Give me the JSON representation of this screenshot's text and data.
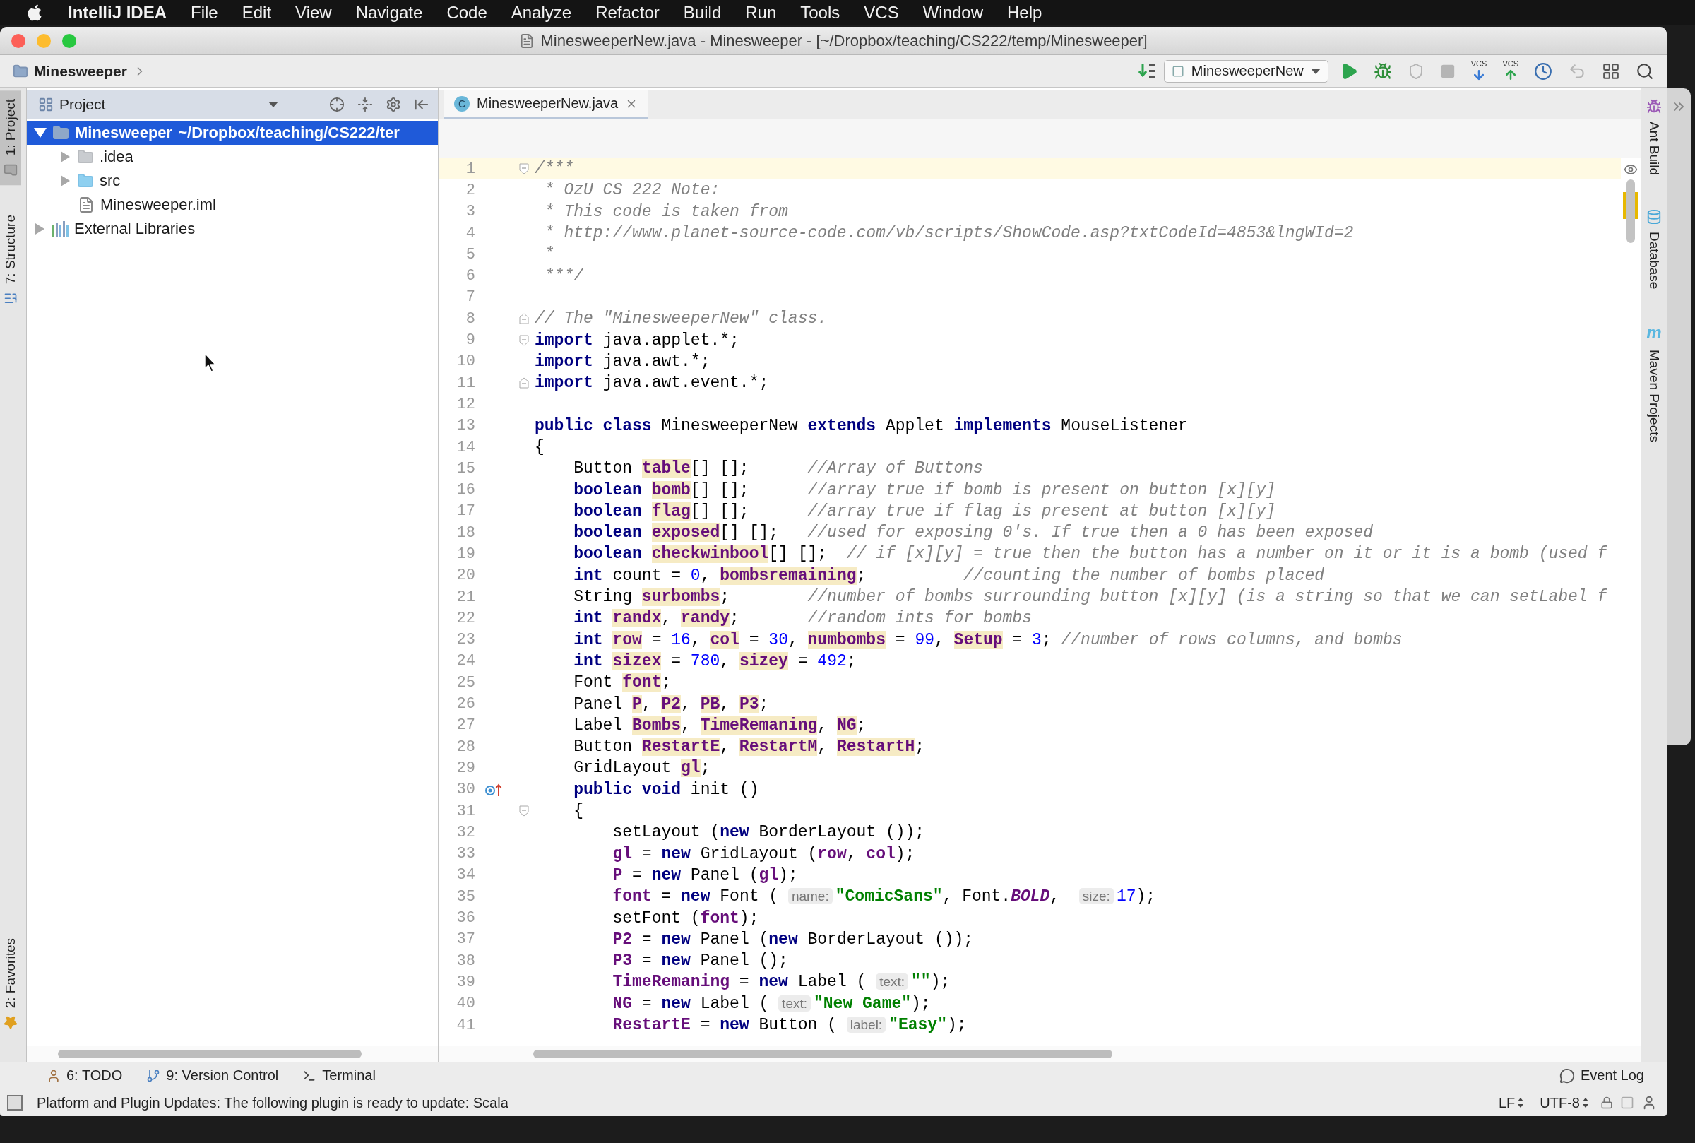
{
  "menu_bar": {
    "app": "IntelliJ IDEA",
    "items": [
      "File",
      "Edit",
      "View",
      "Navigate",
      "Code",
      "Analyze",
      "Refactor",
      "Build",
      "Run",
      "Tools",
      "VCS",
      "Window",
      "Help"
    ]
  },
  "window": {
    "title": "MinesweeperNew.java - Minesweeper - [~/Dropbox/teaching/CS222/temp/Minesweeper]"
  },
  "navigation_bar": {
    "breadcrumb": "Minesweeper",
    "run_config": "MinesweeperNew",
    "toolbar": [
      {
        "kind": "run",
        "disabled": false
      },
      {
        "kind": "debug",
        "disabled": false
      },
      {
        "kind": "coverage",
        "disabled": true
      },
      {
        "kind": "stop",
        "disabled": true
      },
      {
        "kind": "vcs-update",
        "label": "VCS",
        "disabled": false
      },
      {
        "kind": "vcs-commit",
        "label": "VCS",
        "disabled": false
      },
      {
        "kind": "history",
        "disabled": false
      },
      {
        "kind": "revert",
        "disabled": true
      },
      {
        "kind": "structure",
        "disabled": false
      },
      {
        "kind": "search",
        "disabled": false
      }
    ]
  },
  "left_stripe": [
    {
      "label": "1: Project",
      "kind": "project",
      "selected": true
    },
    {
      "label": "7: Structure",
      "kind": "structure",
      "selected": false
    },
    {
      "label": "2: Favorites",
      "kind": "favorites",
      "selected": false
    }
  ],
  "project_panel": {
    "title": "Project",
    "tree": [
      {
        "label": "Minesweeper",
        "path": "~/Dropbox/teaching/CS222/ter",
        "kind": "module",
        "expanded": true,
        "selected": true,
        "children": [
          {
            "label": ".idea",
            "kind": "folder",
            "expanded": false,
            "selected": false
          },
          {
            "label": "src",
            "kind": "source",
            "expanded": false,
            "selected": false
          },
          {
            "label": "Minesweeper.iml",
            "kind": "file",
            "selected": false
          }
        ]
      },
      {
        "label": "External Libraries",
        "kind": "libraries",
        "expanded": false,
        "selected": false
      }
    ]
  },
  "editor": {
    "tabs": [
      {
        "label": "MinesweeperNew.java",
        "badge": "C",
        "selected": true
      }
    ],
    "lines": [
      {
        "n": "1",
        "current": true,
        "fold": {
          "kind": "start"
        },
        "tokens": [
          {
            "kind": "cm",
            "text": "/***"
          }
        ]
      },
      {
        "n": "2",
        "current": false,
        "tokens": [
          {
            "kind": "cm",
            "text": " * OzU CS 222 Note:"
          }
        ]
      },
      {
        "n": "3",
        "current": false,
        "tokens": [
          {
            "kind": "cm",
            "text": " * This code is taken from"
          }
        ]
      },
      {
        "n": "4",
        "current": false,
        "tokens": [
          {
            "kind": "cm",
            "text": " * http://www.planet-source-code.com/vb/scripts/ShowCode.asp?txtCodeId=4853&lngWId=2"
          }
        ]
      },
      {
        "n": "5",
        "current": false,
        "tokens": [
          {
            "kind": "cm",
            "text": " *"
          }
        ]
      },
      {
        "n": "6",
        "current": false,
        "tokens": [
          {
            "kind": "cm",
            "text": " ***/"
          }
        ]
      },
      {
        "n": "7",
        "current": false
      },
      {
        "n": "8",
        "current": false,
        "fold": {
          "kind": "end"
        },
        "tokens": [
          {
            "kind": "cm",
            "text": "// The \"MinesweeperNew\" class."
          }
        ]
      },
      {
        "n": "9",
        "current": false,
        "fold": {
          "kind": "start"
        },
        "tokens": [
          {
            "kind": "kw",
            "text": "import"
          },
          {
            "kind": "tx",
            "text": " java.applet.*;"
          }
        ]
      },
      {
        "n": "10",
        "current": false,
        "tokens": [
          {
            "kind": "kw",
            "text": "import"
          },
          {
            "kind": "tx",
            "text": " java.awt.*;"
          }
        ]
      },
      {
        "n": "11",
        "current": false,
        "fold": {
          "kind": "end"
        },
        "tokens": [
          {
            "kind": "kw",
            "text": "import"
          },
          {
            "kind": "tx",
            "text": " java.awt.event.*;"
          }
        ]
      },
      {
        "n": "12",
        "current": false
      },
      {
        "n": "13",
        "current": false,
        "tokens": [
          {
            "kind": "kw",
            "text": "public class"
          },
          {
            "kind": "tx",
            "text": " MinesweeperNew "
          },
          {
            "kind": "kw",
            "text": "extends"
          },
          {
            "kind": "tx",
            "text": " Applet "
          },
          {
            "kind": "kw",
            "text": "implements"
          },
          {
            "kind": "tx",
            "text": " MouseListener"
          }
        ]
      },
      {
        "n": "14",
        "current": false,
        "tokens": [
          {
            "kind": "tx",
            "text": "{"
          }
        ]
      },
      {
        "n": "15",
        "current": false,
        "tokens": [
          {
            "kind": "tx",
            "text": "    Button "
          },
          {
            "kind": "fdh",
            "text": "table"
          },
          {
            "kind": "tx",
            "text": "[] [];      "
          },
          {
            "kind": "cm",
            "text": "//Array of Buttons"
          }
        ]
      },
      {
        "n": "16",
        "current": false,
        "tokens": [
          {
            "kind": "kw",
            "text": "    boolean "
          },
          {
            "kind": "fdh",
            "text": "bomb"
          },
          {
            "kind": "tx",
            "text": "[] [];      "
          },
          {
            "kind": "cm",
            "text": "//array true if bomb is present on button [x][y]"
          }
        ]
      },
      {
        "n": "17",
        "current": false,
        "tokens": [
          {
            "kind": "kw",
            "text": "    boolean "
          },
          {
            "kind": "fdh",
            "text": "flag"
          },
          {
            "kind": "tx",
            "text": "[] [];      "
          },
          {
            "kind": "cm",
            "text": "//array true if flag is present at button [x][y]"
          }
        ]
      },
      {
        "n": "18",
        "current": false,
        "tokens": [
          {
            "kind": "kw",
            "text": "    boolean "
          },
          {
            "kind": "fdh",
            "text": "exposed"
          },
          {
            "kind": "tx",
            "text": "[] [];   "
          },
          {
            "kind": "cm",
            "text": "//used for exposing 0's. If true then a 0 has been exposed"
          }
        ]
      },
      {
        "n": "19",
        "current": false,
        "tokens": [
          {
            "kind": "kw",
            "text": "    boolean "
          },
          {
            "kind": "fdh",
            "text": "checkwinbool"
          },
          {
            "kind": "tx",
            "text": "[] [];  "
          },
          {
            "kind": "cm",
            "text": "// if [x][y] = true then the button has a number on it or it is a bomb (used f"
          }
        ]
      },
      {
        "n": "20",
        "current": false,
        "tokens": [
          {
            "kind": "kw",
            "text": "    int"
          },
          {
            "kind": "tx",
            "text": " count = "
          },
          {
            "kind": "num",
            "text": "0"
          },
          {
            "kind": "tx",
            "text": ", "
          },
          {
            "kind": "fdh",
            "text": "bombsremaining"
          },
          {
            "kind": "tx",
            "text": ";          "
          },
          {
            "kind": "cm",
            "text": "//counting the number of bombs placed"
          }
        ]
      },
      {
        "n": "21",
        "current": false,
        "tokens": [
          {
            "kind": "tx",
            "text": "    String "
          },
          {
            "kind": "fdh",
            "text": "surbombs"
          },
          {
            "kind": "tx",
            "text": ";        "
          },
          {
            "kind": "cm",
            "text": "//number of bombs surrounding button [x][y] (is a string so that we can setLabel f"
          }
        ]
      },
      {
        "n": "22",
        "current": false,
        "tokens": [
          {
            "kind": "kw",
            "text": "    int "
          },
          {
            "kind": "fdh",
            "text": "randx"
          },
          {
            "kind": "tx",
            "text": ", "
          },
          {
            "kind": "fdh",
            "text": "randy"
          },
          {
            "kind": "tx",
            "text": ";       "
          },
          {
            "kind": "cm",
            "text": "//random ints for bombs"
          }
        ]
      },
      {
        "n": "23",
        "current": false,
        "tokens": [
          {
            "kind": "kw",
            "text": "    int "
          },
          {
            "kind": "fdh",
            "text": "row"
          },
          {
            "kind": "tx",
            "text": " = "
          },
          {
            "kind": "num",
            "text": "16"
          },
          {
            "kind": "tx",
            "text": ", "
          },
          {
            "kind": "fdh",
            "text": "col"
          },
          {
            "kind": "tx",
            "text": " = "
          },
          {
            "kind": "num",
            "text": "30"
          },
          {
            "kind": "tx",
            "text": ", "
          },
          {
            "kind": "fdh",
            "text": "numbombs"
          },
          {
            "kind": "tx",
            "text": " = "
          },
          {
            "kind": "num",
            "text": "99"
          },
          {
            "kind": "tx",
            "text": ", "
          },
          {
            "kind": "fdh",
            "text": "Setup"
          },
          {
            "kind": "tx",
            "text": " = "
          },
          {
            "kind": "num",
            "text": "3"
          },
          {
            "kind": "tx",
            "text": "; "
          },
          {
            "kind": "cm",
            "text": "//number of rows columns, and bombs"
          }
        ]
      },
      {
        "n": "24",
        "current": false,
        "tokens": [
          {
            "kind": "kw",
            "text": "    int "
          },
          {
            "kind": "fdh",
            "text": "sizex"
          },
          {
            "kind": "tx",
            "text": " = "
          },
          {
            "kind": "num",
            "text": "780"
          },
          {
            "kind": "tx",
            "text": ", "
          },
          {
            "kind": "fdh",
            "text": "sizey"
          },
          {
            "kind": "tx",
            "text": " = "
          },
          {
            "kind": "num",
            "text": "492"
          },
          {
            "kind": "tx",
            "text": ";"
          }
        ]
      },
      {
        "n": "25",
        "current": false,
        "tokens": [
          {
            "kind": "tx",
            "text": "    Font "
          },
          {
            "kind": "fdh",
            "text": "font"
          },
          {
            "kind": "tx",
            "text": ";"
          }
        ]
      },
      {
        "n": "26",
        "current": false,
        "tokens": [
          {
            "kind": "tx",
            "text": "    Panel "
          },
          {
            "kind": "fdh",
            "text": "P"
          },
          {
            "kind": "tx",
            "text": ", "
          },
          {
            "kind": "fdh",
            "text": "P2"
          },
          {
            "kind": "tx",
            "text": ", "
          },
          {
            "kind": "fdh",
            "text": "PB"
          },
          {
            "kind": "tx",
            "text": ", "
          },
          {
            "kind": "fdh",
            "text": "P3"
          },
          {
            "kind": "tx",
            "text": ";"
          }
        ]
      },
      {
        "n": "27",
        "current": false,
        "tokens": [
          {
            "kind": "tx",
            "text": "    Label "
          },
          {
            "kind": "fdh",
            "text": "Bombs"
          },
          {
            "kind": "tx",
            "text": ", "
          },
          {
            "kind": "fdh",
            "text": "TimeRemaning"
          },
          {
            "kind": "tx",
            "text": ", "
          },
          {
            "kind": "fdh",
            "text": "NG"
          },
          {
            "kind": "tx",
            "text": ";"
          }
        ]
      },
      {
        "n": "28",
        "current": false,
        "tokens": [
          {
            "kind": "tx",
            "text": "    Button "
          },
          {
            "kind": "fdh",
            "text": "RestartE"
          },
          {
            "kind": "tx",
            "text": ", "
          },
          {
            "kind": "fdh",
            "text": "RestartM"
          },
          {
            "kind": "tx",
            "text": ", "
          },
          {
            "kind": "fdh",
            "text": "RestartH"
          },
          {
            "kind": "tx",
            "text": ";"
          }
        ]
      },
      {
        "n": "29",
        "current": false,
        "tokens": [
          {
            "kind": "tx",
            "text": "    GridLayout "
          },
          {
            "kind": "fdh",
            "text": "gl"
          },
          {
            "kind": "tx",
            "text": ";"
          }
        ]
      },
      {
        "n": "30",
        "current": false,
        "gutter": {
          "kind": "overrides"
        },
        "tokens": [
          {
            "kind": "kw",
            "text": "    public void"
          },
          {
            "kind": "tx",
            "text": " init ()"
          }
        ]
      },
      {
        "n": "31",
        "current": false,
        "fold": {
          "kind": "start"
        },
        "tokens": [
          {
            "kind": "tx",
            "text": "    {"
          }
        ]
      },
      {
        "n": "32",
        "current": false,
        "tokens": [
          {
            "kind": "tx",
            "text": "        setLayout ("
          },
          {
            "kind": "kw",
            "text": "new"
          },
          {
            "kind": "tx",
            "text": " BorderLayout ());"
          }
        ]
      },
      {
        "n": "33",
        "current": false,
        "tokens": [
          {
            "kind": "fd",
            "text": "        gl"
          },
          {
            "kind": "tx",
            "text": " = "
          },
          {
            "kind": "kw",
            "text": "new"
          },
          {
            "kind": "tx",
            "text": " GridLayout ("
          },
          {
            "kind": "fd",
            "text": "row"
          },
          {
            "kind": "tx",
            "text": ", "
          },
          {
            "kind": "fd",
            "text": "col"
          },
          {
            "kind": "tx",
            "text": ");"
          }
        ]
      },
      {
        "n": "34",
        "current": false,
        "tokens": [
          {
            "kind": "fd",
            "text": "        P"
          },
          {
            "kind": "tx",
            "text": " = "
          },
          {
            "kind": "kw",
            "text": "new"
          },
          {
            "kind": "tx",
            "text": " Panel ("
          },
          {
            "kind": "fd",
            "text": "gl"
          },
          {
            "kind": "tx",
            "text": ");"
          }
        ]
      },
      {
        "n": "35",
        "current": false,
        "tokens": [
          {
            "kind": "fd",
            "text": "        font"
          },
          {
            "kind": "tx",
            "text": " = "
          },
          {
            "kind": "kw",
            "text": "new"
          },
          {
            "kind": "tx",
            "text": " Font ( "
          },
          {
            "kind": "hint",
            "text": "name:"
          },
          {
            "kind": "str",
            "text": "\"ComicSans\""
          },
          {
            "kind": "tx",
            "text": ", Font."
          },
          {
            "kind": "sc",
            "text": "BOLD"
          },
          {
            "kind": "tx",
            "text": ",  "
          },
          {
            "kind": "hint",
            "text": "size:"
          },
          {
            "kind": "num",
            "text": "17"
          },
          {
            "kind": "tx",
            "text": ");"
          }
        ]
      },
      {
        "n": "36",
        "current": false,
        "tokens": [
          {
            "kind": "tx",
            "text": "        setFont ("
          },
          {
            "kind": "fd",
            "text": "font"
          },
          {
            "kind": "tx",
            "text": ");"
          }
        ]
      },
      {
        "n": "37",
        "current": false,
        "tokens": [
          {
            "kind": "fd",
            "text": "        P2"
          },
          {
            "kind": "tx",
            "text": " = "
          },
          {
            "kind": "kw",
            "text": "new"
          },
          {
            "kind": "tx",
            "text": " Panel ("
          },
          {
            "kind": "kw",
            "text": "new"
          },
          {
            "kind": "tx",
            "text": " BorderLayout ());"
          }
        ]
      },
      {
        "n": "38",
        "current": false,
        "tokens": [
          {
            "kind": "fd",
            "text": "        P3"
          },
          {
            "kind": "tx",
            "text": " = "
          },
          {
            "kind": "kw",
            "text": "new"
          },
          {
            "kind": "tx",
            "text": " Panel ();"
          }
        ]
      },
      {
        "n": "39",
        "current": false,
        "tokens": [
          {
            "kind": "fd",
            "text": "        TimeRemaning"
          },
          {
            "kind": "tx",
            "text": " = "
          },
          {
            "kind": "kw",
            "text": "new"
          },
          {
            "kind": "tx",
            "text": " Label ( "
          },
          {
            "kind": "hint",
            "text": "text:"
          },
          {
            "kind": "str",
            "text": "\"\""
          },
          {
            "kind": "tx",
            "text": ");"
          }
        ]
      },
      {
        "n": "40",
        "current": false,
        "tokens": [
          {
            "kind": "fd",
            "text": "        NG"
          },
          {
            "kind": "tx",
            "text": " = "
          },
          {
            "kind": "kw",
            "text": "new"
          },
          {
            "kind": "tx",
            "text": " Label ( "
          },
          {
            "kind": "hint",
            "text": "text:"
          },
          {
            "kind": "str",
            "text": "\"New Game\""
          },
          {
            "kind": "tx",
            "text": ");"
          }
        ]
      },
      {
        "n": "41",
        "current": false,
        "tokens": [
          {
            "kind": "fd",
            "text": "        RestartE"
          },
          {
            "kind": "tx",
            "text": " = "
          },
          {
            "kind": "kw",
            "text": "new"
          },
          {
            "kind": "tx",
            "text": " Button ( "
          },
          {
            "kind": "hint",
            "text": "label:"
          },
          {
            "kind": "str",
            "text": "\"Easy\""
          },
          {
            "kind": "tx",
            "text": ");"
          }
        ]
      }
    ]
  },
  "right_stripe": [
    {
      "label": "Ant Build",
      "kind": "ant"
    },
    {
      "label": "Database",
      "kind": "database"
    },
    {
      "label": "Maven Projects",
      "kind": "maven",
      "badge": "m"
    }
  ],
  "tool_windows": [
    {
      "label": "6: TODO",
      "kind": "todo"
    },
    {
      "label": "9: Version Control",
      "kind": "vcs"
    },
    {
      "label": "Terminal",
      "kind": "terminal"
    }
  ],
  "event_log": "Event Log",
  "status_bar": {
    "message": "Platform and Plugin Updates: The following plugin is ready to update: Scala",
    "line_separator": "LF",
    "encoding": "UTF-8"
  }
}
